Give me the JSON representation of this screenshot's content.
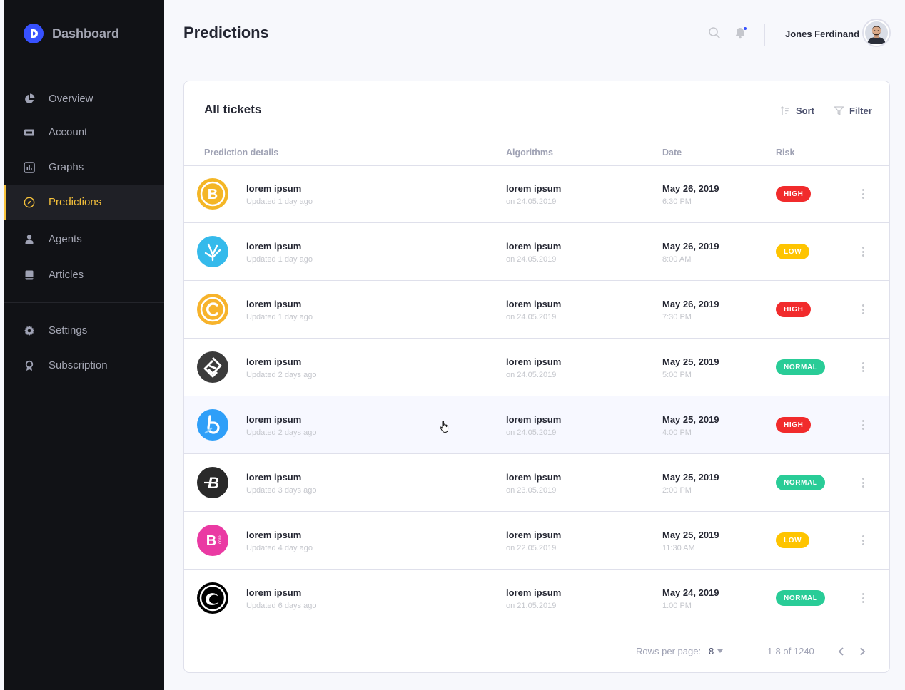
{
  "app": {
    "title": "Dashboard",
    "logo_letter": "D",
    "accent": "#3751ff",
    "active_color": "#f5c13b"
  },
  "sidebar": {
    "items": [
      {
        "label": "Overview",
        "icon": "pie-chart-icon"
      },
      {
        "label": "Account",
        "icon": "ticket-icon"
      },
      {
        "label": "Graphs",
        "icon": "bar-chart-icon"
      },
      {
        "label": "Predictions",
        "icon": "compass-icon",
        "active": true
      },
      {
        "label": "Agents",
        "icon": "user-icon"
      },
      {
        "label": "Articles",
        "icon": "book-icon"
      },
      {
        "label": "Settings",
        "icon": "gear-icon"
      },
      {
        "label": "Subscription",
        "icon": "award-icon"
      }
    ]
  },
  "header": {
    "title": "Predictions",
    "user_name": "Jones Ferdinand"
  },
  "card": {
    "title": "All tickets",
    "sort_label": "Sort",
    "filter_label": "Filter",
    "columns": [
      "Prediction details",
      "Algorithms",
      "Date",
      "Risk"
    ]
  },
  "rows": [
    {
      "icon": "bitcoin-icon",
      "title": "lorem ipsum",
      "updated": "Updated 1 day ago",
      "algo": "lorem ipsum",
      "algo_date": "on 24.05.2019",
      "date": "May 26, 2019",
      "time": "6:30 PM",
      "risk": "HIGH"
    },
    {
      "icon": "bitshares-icon",
      "title": "lorem ipsum",
      "updated": "Updated 1 day ago",
      "algo": "lorem ipsum",
      "algo_date": "on 24.05.2019",
      "date": "May 26, 2019",
      "time": "8:00 AM",
      "risk": "LOW"
    },
    {
      "icon": "coin-c-icon",
      "title": "lorem ipsum",
      "updated": "Updated 1 day ago",
      "algo": "lorem ipsum",
      "algo_date": "on 24.05.2019",
      "date": "May 26, 2019",
      "time": "7:30 PM",
      "risk": "HIGH"
    },
    {
      "icon": "bytom-icon",
      "title": "lorem ipsum",
      "updated": "Updated 2 days ago",
      "algo": "lorem ipsum",
      "algo_date": "on 24.05.2019",
      "date": "May 25, 2019",
      "time": "5:00 PM",
      "risk": "NORMAL"
    },
    {
      "icon": "bluzelle-icon",
      "title": "lorem ipsum",
      "updated": "Updated 2 days ago",
      "algo": "lorem ipsum",
      "algo_date": "on 24.05.2019",
      "date": "May 25, 2019",
      "time": "4:00 PM",
      "risk": "HIGH"
    },
    {
      "icon": "burst-icon",
      "title": "lorem ipsum",
      "updated": "Updated 3 days ago",
      "algo": "lorem ipsum",
      "algo_date": "on 23.05.2019",
      "date": "May 25, 2019",
      "time": "2:00 PM",
      "risk": "NORMAL"
    },
    {
      "icon": "bitcoin-core-icon",
      "title": "lorem ipsum",
      "updated": "Updated 4 day ago",
      "algo": "lorem ipsum",
      "algo_date": "on 22.05.2019",
      "date": "May 25, 2019",
      "time": "11:30 AM",
      "risk": "LOW"
    },
    {
      "icon": "bittorrent-icon",
      "title": "lorem ipsum",
      "updated": "Updated 6 days ago",
      "algo": "lorem ipsum",
      "algo_date": "on 21.05.2019",
      "date": "May 24, 2019",
      "time": "1:00 PM",
      "risk": "NORMAL"
    }
  ],
  "pagination": {
    "rows_label": "Rows per page:",
    "rows_value": "8",
    "range": "1-8 of 1240"
  },
  "risk_colors": {
    "HIGH": "#f12b2c",
    "LOW": "#fec400",
    "NORMAL": "#29cc97"
  }
}
